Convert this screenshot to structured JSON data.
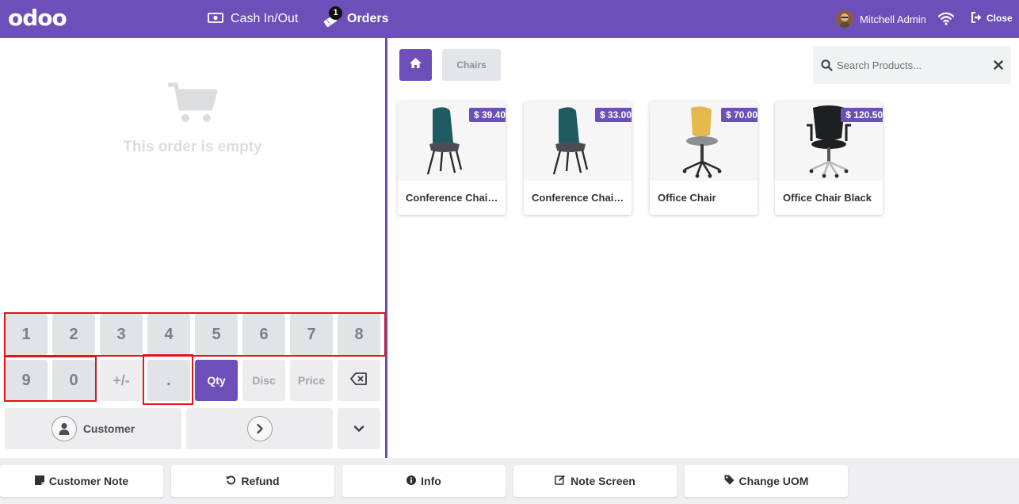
{
  "topbar": {
    "logo": "odoo",
    "cash_label": "Cash In/Out",
    "orders_label": "Orders",
    "orders_badge": "1",
    "user_name": "Mitchell Admin",
    "close_label": "Close"
  },
  "order": {
    "empty_text": "This order is empty"
  },
  "numpad": {
    "keys_row1": [
      "1",
      "2",
      "3",
      "4",
      "5",
      "6",
      "7",
      "8"
    ],
    "keys_row2": [
      "9",
      "0",
      "+/-",
      "."
    ],
    "qty_label": "Qty",
    "disc_label": "Disc",
    "price_label": "Price",
    "customer_label": "Customer"
  },
  "products_header": {
    "category_label": "Chairs",
    "search_placeholder": "Search Products..."
  },
  "products": [
    {
      "name": "Conference Chair (Steel)",
      "price": "$ 39.40",
      "variant": "teal"
    },
    {
      "name": "Conference Chair (Aluminium)",
      "price": "$ 33.00",
      "variant": "teal"
    },
    {
      "name": "Office Chair",
      "price": "$ 70.00",
      "variant": "yellow"
    },
    {
      "name": "Office Chair Black",
      "price": "$ 120.50",
      "variant": "black"
    }
  ],
  "actions": [
    {
      "label": "Customer Note",
      "icon": "note-icon"
    },
    {
      "label": "Refund",
      "icon": "undo-icon"
    },
    {
      "label": "Info",
      "icon": "info-icon"
    },
    {
      "label": "Note Screen",
      "icon": "edit-icon"
    },
    {
      "label": "Change UOM",
      "icon": "tag-icon"
    }
  ],
  "colors": {
    "brand": "#6c4fb8",
    "highlight": "#e0141b"
  }
}
